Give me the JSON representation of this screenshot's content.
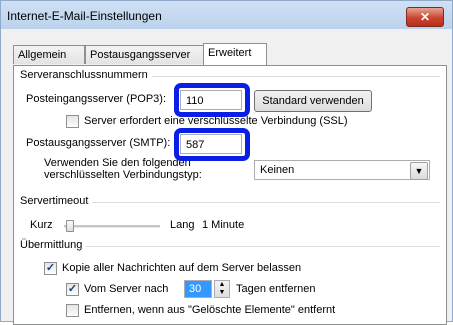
{
  "window": {
    "title": "Internet-E-Mail-Einstellungen",
    "close_symbol": "✕"
  },
  "tabs": [
    {
      "label": "Allgemein",
      "active": false
    },
    {
      "label": "Postausgangsserver",
      "active": false
    },
    {
      "label": "Erweitert",
      "active": true
    }
  ],
  "server_ports": {
    "group_label": "Serveranschlussnummern",
    "incoming_label": "Posteingangsserver (POP3):",
    "incoming_value": "110",
    "default_button": "Standard verwenden",
    "ssl_label": "Server erfordert eine verschlüsselte Verbindung (SSL)",
    "ssl_checked": false,
    "outgoing_label": "Postausgangsserver (SMTP):",
    "outgoing_value": "587",
    "encryption_label_line1": "Verwenden Sie den folgenden",
    "encryption_label_line2": "verschlüsselten Verbindungstyp:",
    "encryption_value": "Keinen"
  },
  "timeout": {
    "group_label": "Servertimeout",
    "short_label": "Kurz",
    "long_label": "Lang",
    "value_text": "1 Minute",
    "slider_level": 0.0
  },
  "delivery": {
    "group_label": "Übermittlung",
    "keep_copy_label": "Kopie aller Nachrichten auf dem Server belassen",
    "keep_copy_checked": true,
    "remove_after_label": "Vom Server nach",
    "remove_after_days": "30",
    "remove_after_suffix": "Tagen entfernen",
    "remove_after_checked": true,
    "remove_deleted_label": "Entfernen, wenn aus \"Gelöschte Elemente\" entfernt",
    "remove_deleted_checked": false
  },
  "colors": {
    "highlight": "#0a1fe6",
    "selection": "#3399ff"
  }
}
